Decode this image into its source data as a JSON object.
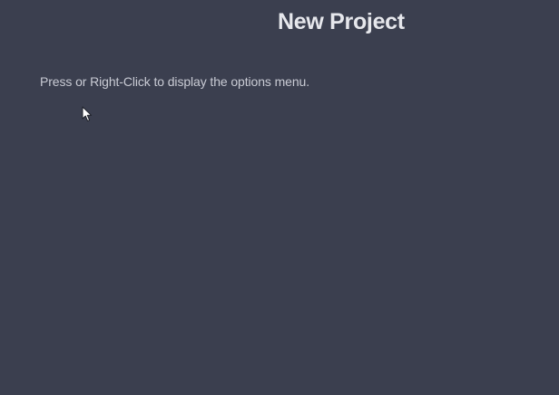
{
  "project": {
    "title": "New Project"
  },
  "canvas": {
    "hint": "Press or Right-Click to display the options menu.",
    "background_color": "#3b3f4f"
  },
  "pointer": {
    "icon": "arrow-cursor-icon"
  }
}
